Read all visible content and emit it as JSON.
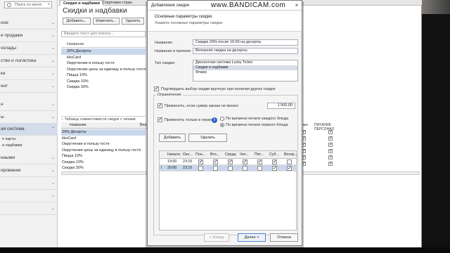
{
  "recorder": {
    "watermark": "www.BANDICAM.com"
  },
  "sidebar": {
    "search_placeholder": "Поиск по меню",
    "items": [
      {
        "label": "ное"
      },
      {
        "label": "е продажи"
      },
      {
        "label": "склады"
      },
      {
        "label": "ство и логистика"
      },
      {
        "label": "ки"
      },
      {
        "label": "ент"
      },
      {
        "label": "н"
      },
      {
        "label": "ы"
      },
      {
        "label": "ая система"
      },
      {
        "label": "нными"
      },
      {
        "label": "ирование"
      }
    ],
    "sub_items": [
      "е карты",
      "и надбавки"
    ]
  },
  "tabs": {
    "active": "Скидки и надбавки",
    "other": "Стартовая стран"
  },
  "page": {
    "title": "Скидки и надбавки",
    "add_label": "Добавить...",
    "edit_label": "Изменить...",
    "delete_label": "Удалить",
    "search_placeholder": "Введите текст для поиска...",
    "list_header": "Название",
    "discounts": [
      "20% Десерты",
      "iikoCard",
      "Округление в пользу гостя",
      "Округление цены за единицу в пользу гостя",
      "Пицца 10%",
      "Скидка 10%",
      "Скидка 30%"
    ],
    "compat_header": "Таблица совместимости скидок с типами оплат",
    "grid_col": "Название",
    "grid_col2": "Вне",
    "compat_rows": [
      "20% Десерты",
      "iikoCard",
      "Округление в пользу гостя",
      "Округление цены за единицу в пользу гостя",
      "Пицца 10%",
      "Скидка 10%",
      "Скидка 30%"
    ],
    "right_col1": "ные",
    "right_col2": "ПИТАНИЕ ПЕРСОНАЛ"
  },
  "dialog": {
    "title": "Добавление скидки",
    "heading": "Основные параметры скидки.",
    "subheading": "Укажите основные параметры скидки.",
    "name_label": "Название:",
    "name_value": "Скидка 20% после 19.00 на десерты",
    "receipt_label": "Название в пречеке:",
    "receipt_value": "Вечерняя скидка на десерты",
    "type_label": "Тип скидки:",
    "types": [
      "Дисконтная система Lucky Ticket",
      "Скидки и надбавки",
      "Флаер"
    ],
    "selected_type": "Скидки и надбавки",
    "confirm_label": "Подтвердить выбор скидки вручную при наличии других скидок",
    "limits_legend": "Ограничения",
    "min_sum_label": "Применять, если сумма заказа не менее:",
    "min_sum_value": "1 500,00",
    "period_label": "Применять только в период:",
    "radio1_label": "По времени печати каждого блюда",
    "radio2_label": "По времени печати первого блюда",
    "add_label": "Добавить",
    "delete_label": "Удалить",
    "table": {
      "headers": [
        "Начало",
        "Око...",
        "Пон...",
        "Вто...",
        "Среда",
        "Чет...",
        "Пят...",
        "Суб...",
        "Воскр..."
      ],
      "rows": [
        {
          "start": "19:00",
          "end": "23:15",
          "days": [
            true,
            true,
            true,
            true,
            true,
            true,
            false
          ]
        },
        {
          "start": "20:00",
          "end": "23:15",
          "days": [
            false,
            false,
            false,
            false,
            false,
            true,
            true
          ]
        }
      ]
    },
    "back_label": "< Назад",
    "next_label": "Далее >",
    "cancel_label": "Отмена"
  }
}
